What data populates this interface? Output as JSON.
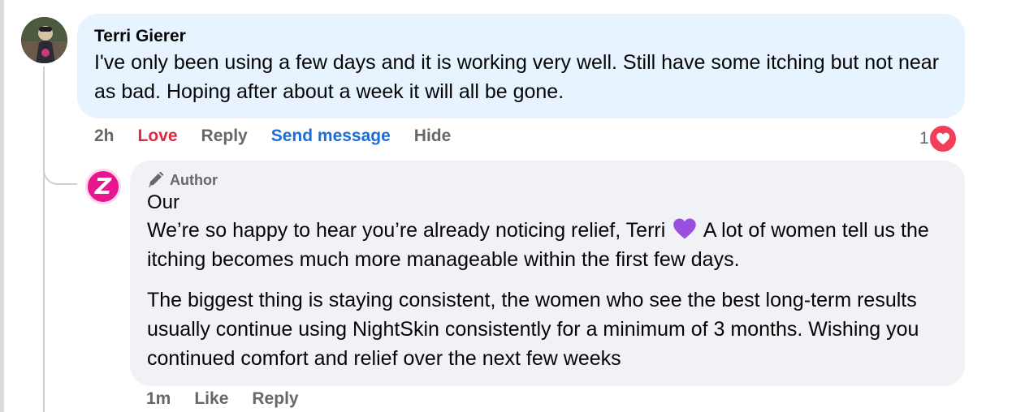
{
  "comment": {
    "author": "Terri Gierer",
    "text": "I've only been using a few days and it is working very well. Still have some itching but not near as bad. Hoping after about a week it will all be gone.",
    "actions": {
      "time": "2h",
      "love": "Love",
      "reply": "Reply",
      "send_message": "Send message",
      "hide": "Hide"
    },
    "reaction_count": "1",
    "reaction_icon": "heart-icon"
  },
  "reply": {
    "badge": "Author",
    "author": "Our",
    "avatar_letter": "Z",
    "paragraph1_part1": "We’re so happy to hear you’re already noticing relief, Terri",
    "paragraph1_part2": "A lot of women tell us the itching becomes much more manageable within the first few days.",
    "paragraph2": "The biggest thing is staying consistent, the women who see the best long-term results usually continue using NightSkin consistently for a minimum of 3 months. Wishing you continued comfort and relief over the next few weeks",
    "actions": {
      "time": "1m",
      "like": "Like",
      "reply": "Reply"
    }
  },
  "colors": {
    "main_bubble": "#e7f3ff",
    "reply_bubble": "#f0f2f5",
    "love": "#e4253f",
    "send_message": "#1a6ed8",
    "brand_pink": "#e8168e"
  }
}
